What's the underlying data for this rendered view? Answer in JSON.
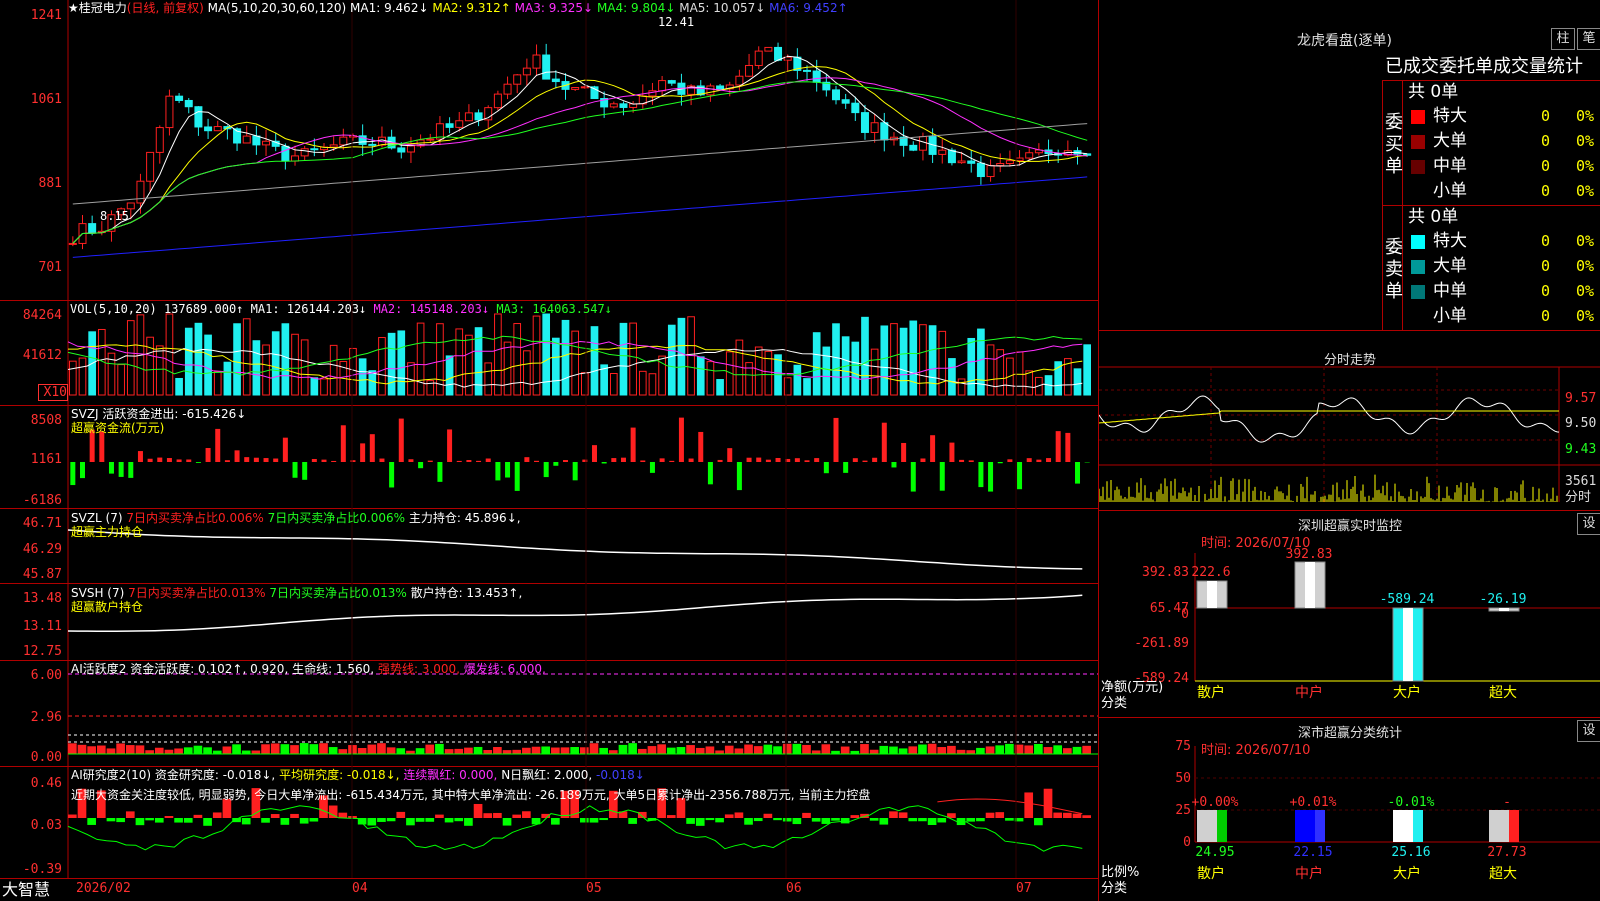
{
  "colors": {
    "up": "#ff2020",
    "down": "#20f0f0",
    "ma1": "#ffffff",
    "ma2": "#ffff00",
    "ma3": "#ff30ff",
    "ma4": "#20ff20",
    "ma5": "#a0a0a0",
    "ma6": "#2020ff",
    "grid": "#b00000"
  },
  "header": {
    "stock": "★桂冠电力",
    "mode": "(日线, 前复权)",
    "ma_label": "MA(5,10,20,30,60,120)",
    "ma1": "MA1: 9.462↓",
    "ma2": "MA2: 9.312↑",
    "ma3": "MA3: 9.325↓",
    "ma4": "MA4: 9.804↓",
    "ma5": "MA5: 10.057↓",
    "ma6": "MA6: 9.452↑",
    "high_mark": "12.41",
    "low_mark": "8.15"
  },
  "price_axis": [
    "1241",
    "1061",
    "881",
    "701"
  ],
  "vol": {
    "label": "VOL(5,10,20)",
    "value": "137689.000↑",
    "ma1": "MA1: 126144.203↓",
    "ma2": "MA2: 145148.203↓",
    "ma3": "MA3: 164063.547↓",
    "axis": [
      "84264",
      "41612",
      "X10"
    ]
  },
  "svzj": {
    "label": "SVZJ  活跃资金进出: -615.426↓",
    "sub": "超赢资金流(万元)",
    "axis": [
      "8508",
      "1161",
      "-6186"
    ]
  },
  "svzl": {
    "label": "SVZL (7)",
    "a": "7日内买卖净占比0.006%",
    "b": "7日内买卖净占比0.006%",
    "c": "主力持仓: 45.896↓,",
    "sub": "超赢主力持仓",
    "axis": [
      "46.71",
      "46.29",
      "45.87"
    ]
  },
  "svsh": {
    "label": "SVSH (7)",
    "a": "7日内买卖净占比0.013%",
    "b": "7日内买卖净占比0.013%",
    "c": "散户持仓: 13.453↑,",
    "sub": "超赢散户持仓",
    "axis": [
      "13.48",
      "13.11",
      "12.75"
    ]
  },
  "ai1": {
    "label": "AI活跃度2 资金活跃度: 0.102↑, 0.920, 生命线: 1.560,",
    "strong": "强势线: 3.000,",
    "burst": "爆发线: 6.000,",
    "axis": [
      "6.00",
      "2.96",
      "0.00"
    ]
  },
  "ai2": {
    "label": "AI研究度2(10) 资金研究度: -0.018↓,",
    "avg": "平均研究度: -0.018↓,",
    "red": "连续飘红: 0.000,",
    "nred": "N日飘红: 2.000,",
    "last": "-0.018↓",
    "desc": "近期大资金关注度较低, 明显弱势, 今日大单净流出: -615.434万元, 其中特大单净流出: -26.189万元, 大单5日累计净出-2356.788万元, 当前主力控盘",
    "axis": [
      "0.46",
      "0.03",
      "-0.39"
    ]
  },
  "xaxis": {
    "brand": "大智慧",
    "labels": [
      "2026/02",
      "04",
      "05",
      "06",
      "07"
    ]
  },
  "right": {
    "lhb_title": "龙虎看盘(逐单)",
    "btn1": "柱",
    "btn2": "笔",
    "tabs": "已成交委托单成交量统计",
    "buy": {
      "side": "委买单",
      "total": "共 0单",
      "rows": [
        {
          "name": "特大",
          "v": "0",
          "p": "0%",
          "c": "#ff0000"
        },
        {
          "name": "大单",
          "v": "0",
          "p": "0%",
          "c": "#990000"
        },
        {
          "name": "中单",
          "v": "0",
          "p": "0%",
          "c": "#660000"
        },
        {
          "name": "小单",
          "v": "0",
          "p": "0%",
          "c": "#000000"
        }
      ]
    },
    "sell": {
      "side": "委卖单",
      "total": "共 0单",
      "rows": [
        {
          "name": "特大",
          "v": "0",
          "p": "0%",
          "c": "#00ffff"
        },
        {
          "name": "大单",
          "v": "0",
          "p": "0%",
          "c": "#009999"
        },
        {
          "name": "中单",
          "v": "0",
          "p": "0%",
          "c": "#007777"
        },
        {
          "name": "小单",
          "v": "0",
          "p": "0%",
          "c": "#000000"
        }
      ]
    },
    "fs_title": "分时走势",
    "fs_axis": [
      "9.57",
      "9.50",
      "9.43"
    ],
    "fs_vol": "3561",
    "fs_label": "分时",
    "mon_title": "深圳超赢实时监控",
    "set": "设",
    "mon_time": "时间: 2026/07/10",
    "mon_axis": [
      "392.83",
      "65.47",
      "0",
      "-261.89",
      "-589.24"
    ],
    "mon_vals": [
      "222.6",
      "392.83",
      "-589.24",
      "-26.19"
    ],
    "mon_unit": "净额(万元)",
    "mon_cat": "分类",
    "cats": [
      "散户",
      "中户",
      "大户",
      "超大"
    ],
    "cls_title": "深市超赢分类统计",
    "cls_time": "时间: 2026/07/10",
    "cls_axis": [
      "75",
      "50",
      "25",
      "0"
    ],
    "cls_top": [
      "+0.00%",
      "+0.01%",
      "-0.01%",
      "-"
    ],
    "cls_vals": [
      "24.95",
      "22.15",
      "25.16",
      "27.73"
    ],
    "cls_unit": "比例%",
    "cls_cat": "分类"
  }
}
